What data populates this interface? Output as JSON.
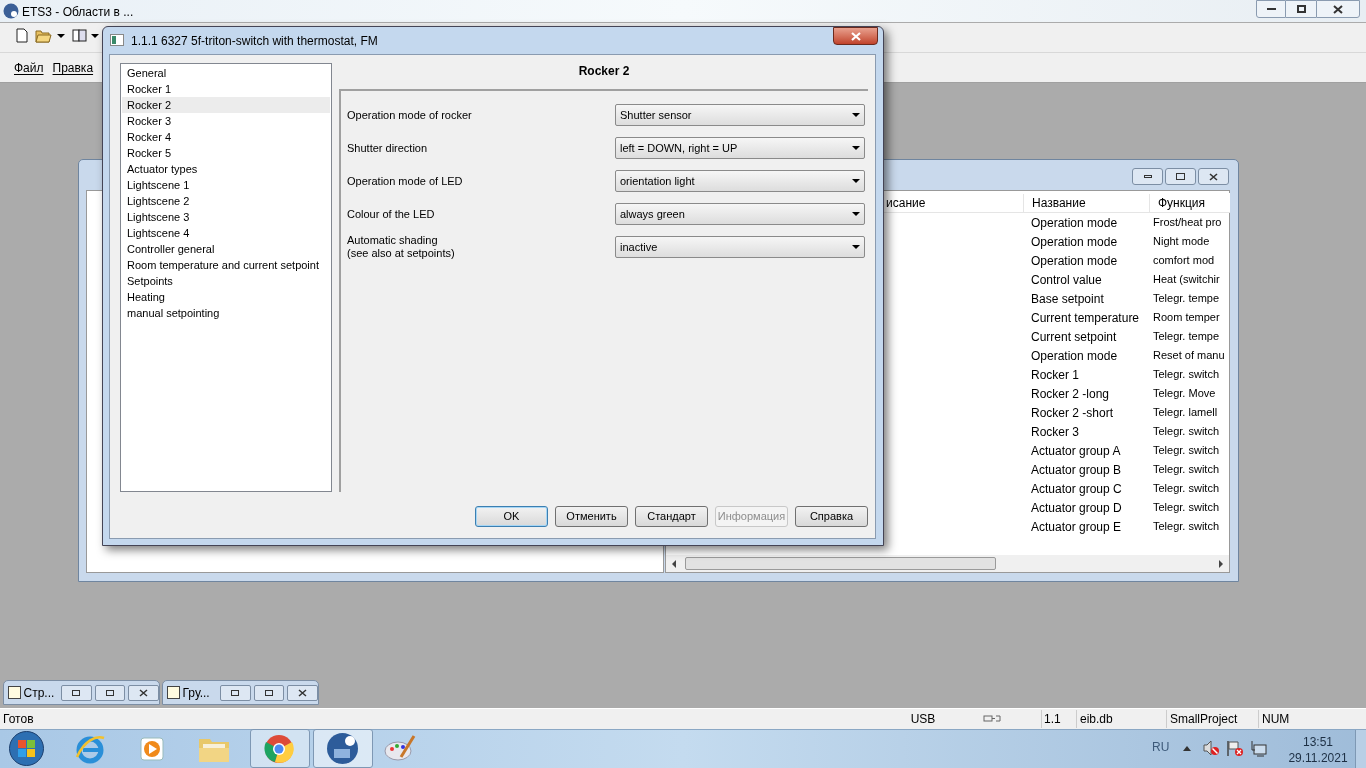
{
  "app": {
    "title": "ETS3 - Области в ...",
    "menu": [
      "Файл",
      "Правка"
    ]
  },
  "child_window": {
    "columns": [
      "исание",
      "Название",
      "Функция"
    ],
    "rows": [
      {
        "name": "Operation mode",
        "function": "Frost/heat pro"
      },
      {
        "name": "Operation mode",
        "function": "Night mode"
      },
      {
        "name": "Operation mode",
        "function": "comfort mod"
      },
      {
        "name": "Control value",
        "function": "Heat (switchir"
      },
      {
        "name": "Base setpoint",
        "function": "Telegr. tempe"
      },
      {
        "name": "Current temperature",
        "function": "Room temper"
      },
      {
        "name": "Current setpoint",
        "function": "Telegr. tempe"
      },
      {
        "name": "Operation mode",
        "function": "Reset of manu"
      },
      {
        "name": "Rocker 1",
        "function": "Telegr. switch"
      },
      {
        "name": "Rocker 2 -long",
        "function": "Telegr. Move"
      },
      {
        "name": "Rocker 2 -short",
        "function": "Telegr. lamell"
      },
      {
        "name": "Rocker 3",
        "function": "Telegr. switch"
      },
      {
        "name": "Actuator group A",
        "function": "Telegr. switch"
      },
      {
        "name": "Actuator group B",
        "function": "Telegr. switch"
      },
      {
        "name": "Actuator group C",
        "function": "Telegr. switch"
      },
      {
        "name": "Actuator group D",
        "function": "Telegr. switch"
      },
      {
        "name": "Actuator group E",
        "function": "Telegr. switch"
      }
    ]
  },
  "dialog": {
    "title": "1.1.1 6327 5f-triton-switch with thermostat, FM",
    "heading": "Rocker 2",
    "pages": [
      {
        "label": "General",
        "selected": false
      },
      {
        "label": "Rocker 1",
        "selected": false
      },
      {
        "label": "Rocker 2",
        "selected": true
      },
      {
        "label": "Rocker 3",
        "selected": false
      },
      {
        "label": "Rocker 4",
        "selected": false
      },
      {
        "label": "Rocker 5",
        "selected": false
      },
      {
        "label": "Actuator types",
        "selected": false
      },
      {
        "label": "Lightscene 1",
        "selected": false
      },
      {
        "label": "Lightscene 2",
        "selected": false
      },
      {
        "label": "Lightscene 3",
        "selected": false
      },
      {
        "label": "Lightscene 4",
        "selected": false
      },
      {
        "label": "Controller general",
        "selected": false
      },
      {
        "label": "Room temperature  and current setpoint",
        "selected": false
      },
      {
        "label": "Setpoints",
        "selected": false
      },
      {
        "label": "Heating",
        "selected": false
      },
      {
        "label": "manual setpointing",
        "selected": false
      }
    ],
    "parameters": [
      {
        "label": "Operation mode of rocker",
        "value": "Shutter sensor"
      },
      {
        "label": "Shutter direction",
        "value": "left = DOWN, right = UP"
      },
      {
        "label": "Operation mode of LED",
        "value": "orientation light"
      },
      {
        "label": "Colour of the LED",
        "value": "always green"
      },
      {
        "label": "Automatic shading\n(see also at setpoints)",
        "value": "inactive"
      }
    ],
    "buttons": [
      {
        "label": "OK",
        "disabled": false,
        "default": true
      },
      {
        "label": "Отменить",
        "disabled": false,
        "default": false
      },
      {
        "label": "Стандарт",
        "disabled": false,
        "default": false
      },
      {
        "label": "Информация",
        "disabled": true,
        "default": false
      },
      {
        "label": "Справка",
        "disabled": false,
        "default": false
      }
    ]
  },
  "minimized_windows": [
    "Стр...",
    "Гру..."
  ],
  "status_bar": {
    "message": "Готов",
    "interface": "USB",
    "address": "1.1",
    "database": "eib.db",
    "project": "SmallProject",
    "num_lock": "NUM"
  },
  "taskbar": {
    "language": "RU",
    "time": "13:51",
    "date": "29.11.2021"
  }
}
